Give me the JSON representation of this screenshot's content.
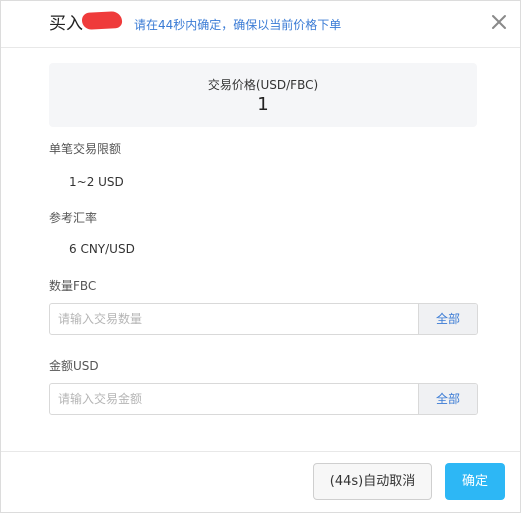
{
  "header": {
    "title": "买入",
    "notice": "请在44秒内确定，确保以当前价格下单",
    "close_icon": "close-icon"
  },
  "price": {
    "label": "交易价格(USD/FBC)",
    "value": "1"
  },
  "limit": {
    "label": "单笔交易限额",
    "value": "1~2 USD"
  },
  "rate": {
    "label": "参考汇率",
    "value": "6 CNY/USD"
  },
  "quantity": {
    "label": "数量FBC",
    "placeholder": "请输入交易数量",
    "value": "",
    "all_label": "全部"
  },
  "amount": {
    "label": "金额USD",
    "placeholder": "请输入交易金额",
    "value": "",
    "all_label": "全部"
  },
  "footer": {
    "cancel_label": "(44s)自动取消",
    "confirm_label": "确定"
  },
  "colors": {
    "accent": "#2db7f5",
    "link": "#3a7bd5",
    "redaction": "#ef3b3b"
  }
}
